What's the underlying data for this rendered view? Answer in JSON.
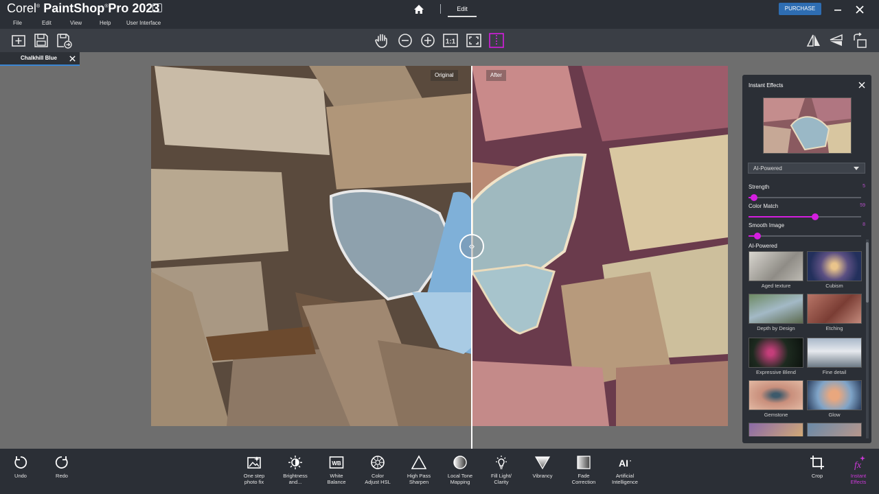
{
  "app": {
    "brand_corel": "Corel",
    "brand_reg": "®",
    "brand_name": "PaintShop",
    "brand_pro": "Pro 2023",
    "edit_tab": "Edit",
    "purchase": "PURCHASE"
  },
  "menu": [
    "File",
    "Edit",
    "View",
    "Help",
    "User Interface"
  ],
  "document": {
    "tab_label": "Chalkhill Blue"
  },
  "compare": {
    "original_label": "Original",
    "after_label": "After"
  },
  "panel": {
    "title": "Instant Effects",
    "category": "AI-Powered",
    "sliders": [
      {
        "label": "Strength",
        "value": "5",
        "fraction": 0.05
      },
      {
        "label": "Color Match",
        "value": "59",
        "fraction": 0.59
      },
      {
        "label": "Smooth Image",
        "value": "8",
        "fraction": 0.08
      }
    ],
    "section_label": "AI-Powered",
    "effects": [
      {
        "name": "Aged texture"
      },
      {
        "name": "Cubism"
      },
      {
        "name": "Depth by Design"
      },
      {
        "name": "Etching"
      },
      {
        "name": "Expressive Blend"
      },
      {
        "name": "Fine detail"
      },
      {
        "name": "Gemstone"
      },
      {
        "name": "Glow"
      },
      {
        "name": ""
      },
      {
        "name": ""
      }
    ]
  },
  "bottom": {
    "undo": "Undo",
    "redo": "Redo",
    "tools": [
      {
        "l1": "One step",
        "l2": "photo fix",
        "icon": "photo-fix-icon"
      },
      {
        "l1": "Brightness",
        "l2": "and...",
        "icon": "brightness-icon"
      },
      {
        "l1": "White",
        "l2": "Balance",
        "icon": "white-balance-icon"
      },
      {
        "l1": "Color",
        "l2": "Adjust HSL",
        "icon": "hsl-icon"
      },
      {
        "l1": "High Pass",
        "l2": "Sharpen",
        "icon": "sharpen-icon"
      },
      {
        "l1": "Local Tone",
        "l2": "Mapping",
        "icon": "tone-mapping-icon"
      },
      {
        "l1": "Fill Light/",
        "l2": "Clarity",
        "icon": "fill-light-icon"
      },
      {
        "l1": "Vibrancy",
        "l2": "",
        "icon": "vibrancy-icon"
      },
      {
        "l1": "Fade",
        "l2": "Correction",
        "icon": "fade-correction-icon"
      },
      {
        "l1": "Artificial",
        "l2": "Intelligence",
        "icon": "ai-icon"
      }
    ],
    "crop": "Crop",
    "instant_l1": "Instant",
    "instant_l2": "Effects"
  },
  "colors": {
    "accent": "#d51ee0",
    "purchase": "#2e6db2",
    "chrome": "#2b2f36"
  }
}
